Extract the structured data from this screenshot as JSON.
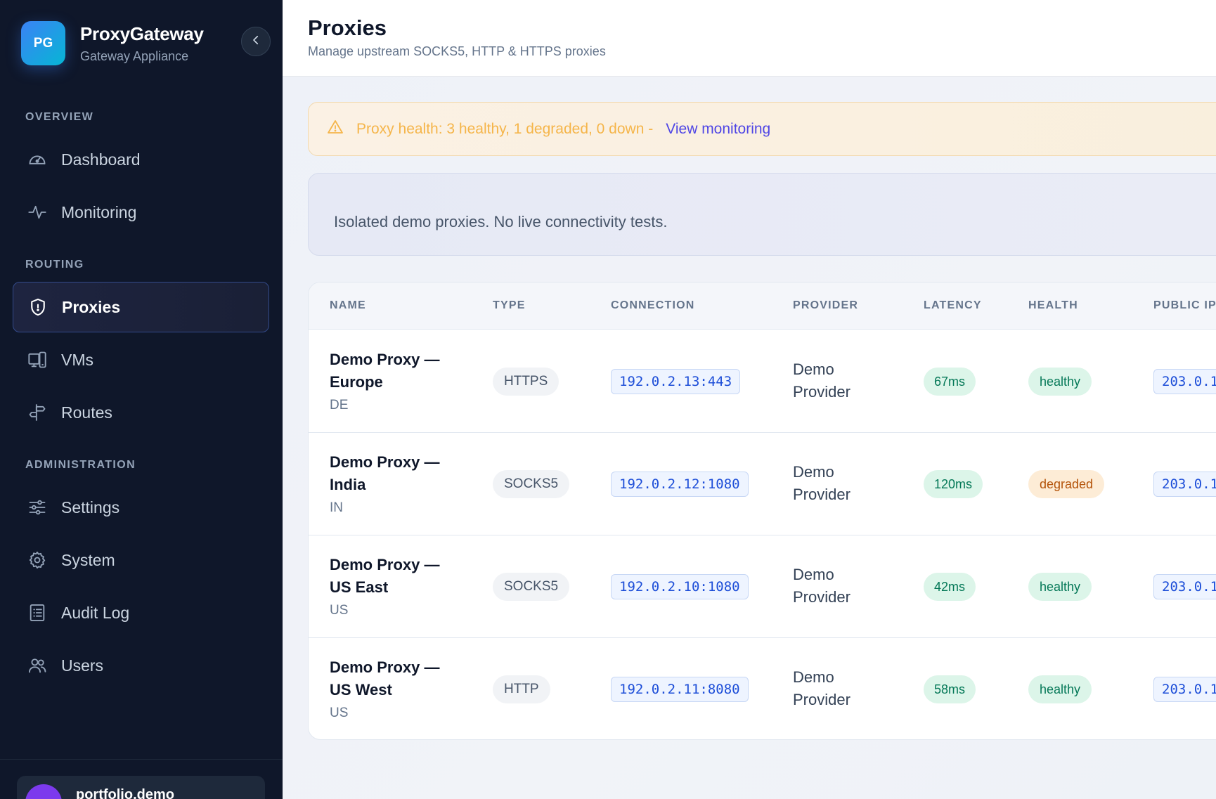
{
  "brand": {
    "initials": "PG",
    "name": "ProxyGateway",
    "subtitle": "Gateway Appliance"
  },
  "sidebar": {
    "sections": [
      {
        "label": "OVERVIEW"
      },
      {
        "label": "ROUTING"
      },
      {
        "label": "ADMINISTRATION"
      }
    ],
    "items": [
      {
        "label": "Dashboard",
        "icon": "gauge-icon"
      },
      {
        "label": "Monitoring",
        "icon": "activity-icon"
      },
      {
        "label": "Proxies",
        "icon": "shield-icon",
        "active": true
      },
      {
        "label": "VMs",
        "icon": "devices-icon"
      },
      {
        "label": "Routes",
        "icon": "signpost-icon"
      },
      {
        "label": "Settings",
        "icon": "sliders-icon"
      },
      {
        "label": "System",
        "icon": "gear-icon"
      },
      {
        "label": "Audit Log",
        "icon": "list-icon"
      },
      {
        "label": "Users",
        "icon": "users-icon"
      }
    ],
    "user": {
      "name": "portfolio.demo"
    }
  },
  "header": {
    "title": "Proxies",
    "subtitle": "Manage upstream SOCKS5, HTTP & HTTPS proxies"
  },
  "alert": {
    "icon": "warning-icon",
    "text": "Proxy health: 3 healthy, 1 degraded, 0 down -",
    "link": "View monitoring"
  },
  "info": {
    "text": "Isolated demo proxies. No live connectivity tests."
  },
  "table": {
    "columns": [
      "NAME",
      "TYPE",
      "CONNECTION",
      "PROVIDER",
      "LATENCY",
      "HEALTH",
      "PUBLIC IP"
    ],
    "rows": [
      {
        "name": "Demo Proxy — Europe",
        "country": "DE",
        "type": "HTTPS",
        "connection": "192.0.2.13:443",
        "provider": "Demo Provider",
        "latency": "67ms",
        "health": "healthy",
        "public_ip": "203.0.1"
      },
      {
        "name": "Demo Proxy — India",
        "country": "IN",
        "type": "SOCKS5",
        "connection": "192.0.2.12:1080",
        "provider": "Demo Provider",
        "latency": "120ms",
        "health": "degraded",
        "public_ip": "203.0.1"
      },
      {
        "name": "Demo Proxy — US East",
        "country": "US",
        "type": "SOCKS5",
        "connection": "192.0.2.10:1080",
        "provider": "Demo Provider",
        "latency": "42ms",
        "health": "healthy",
        "public_ip": "203.0.1"
      },
      {
        "name": "Demo Proxy — US West",
        "country": "US",
        "type": "HTTP",
        "connection": "192.0.2.11:8080",
        "provider": "Demo Provider",
        "latency": "58ms",
        "health": "healthy",
        "public_ip": "203.0.1"
      }
    ]
  },
  "colors": {
    "sidebar_bg": "#0f172a",
    "accent": "#3b82f6",
    "healthy": "#047857",
    "degraded": "#b45309",
    "alert_text": "#f5b54a",
    "link": "#4f46e5"
  }
}
